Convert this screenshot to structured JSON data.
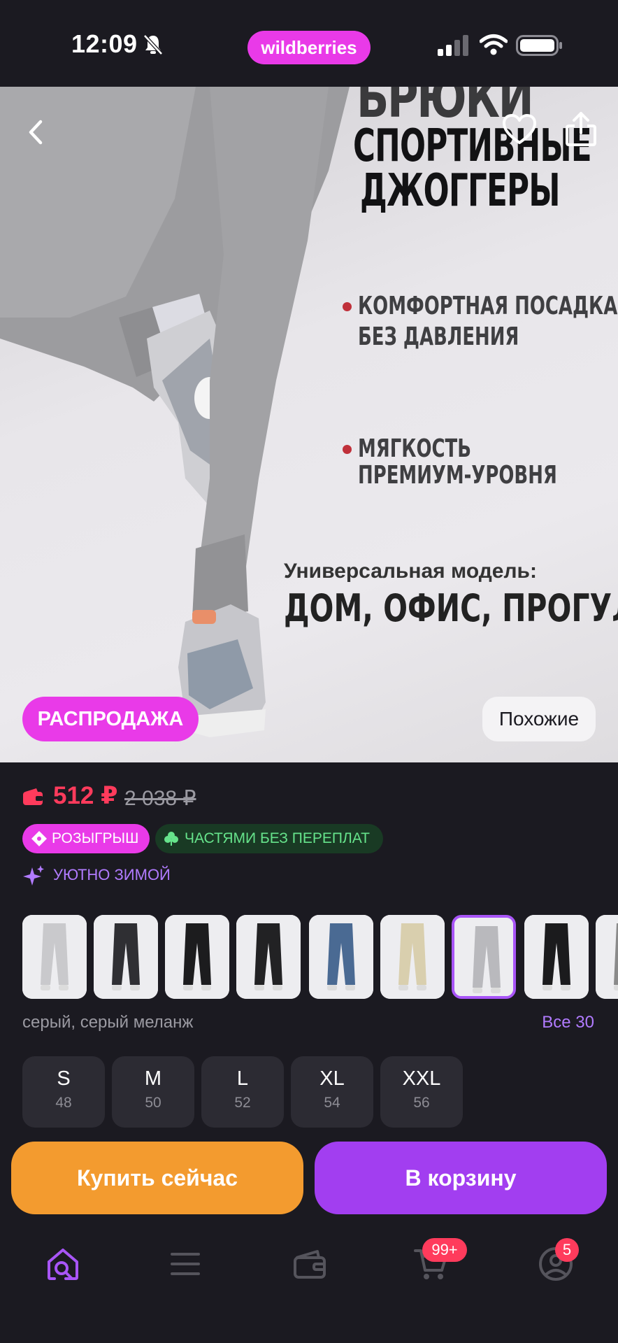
{
  "status_bar": {
    "time": "12:09",
    "app_logo": "wildberries"
  },
  "hero": {
    "title_top": "БРЮКИ",
    "title_line1": "СПОРТИВНЫЕ",
    "title_line2": "ДЖОГГЕРЫ",
    "feature1_line1": "КОМФОРТНАЯ ПОСАДКА",
    "feature1_line2": "БЕЗ ДАВЛЕНИЯ",
    "feature2_line1": "МЯГКОСТЬ",
    "feature2_line2": "ПРЕМИУМ-УРОВНЯ",
    "universal_line1": "Универсальная модель:",
    "universal_line2": "ДОМ, ОФИС, ПРОГУЛКИ",
    "sale_badge": "РАСПРОДАЖА",
    "similar_button": "Похожие"
  },
  "price": {
    "current": "512 ₽",
    "old": "2 038 ₽",
    "accent_color": "#ff3b5c"
  },
  "chips": {
    "raffle": "РОЗЫГРЫШ",
    "installments": "ЧАСТЯМИ БЕЗ ПЕРЕПЛАТ",
    "cozy": "УЮТНО ЗИМОЙ"
  },
  "variants": {
    "selected_index": 6,
    "thumb_colors": [
      "#c9c9cc",
      "#2f2f33",
      "#1c1c1e",
      "#222224",
      "#4a6a93",
      "#d9cfae",
      "#b9b9bd",
      "#1b1b1d",
      "#8a8a8a"
    ],
    "color_label": "серый, серый меланж",
    "all_link": "Все 30"
  },
  "sizes": [
    {
      "size": "S",
      "ru": "48"
    },
    {
      "size": "M",
      "ru": "50"
    },
    {
      "size": "L",
      "ru": "52"
    },
    {
      "size": "XL",
      "ru": "54"
    },
    {
      "size": "XXL",
      "ru": "56"
    }
  ],
  "actions": {
    "buy_now": "Купить сейчас",
    "add_to_cart": "В корзину"
  },
  "tabbar": {
    "items": [
      "home-search-icon",
      "menu-icon",
      "wallet-icon",
      "cart-icon",
      "profile-icon"
    ],
    "cart_badge": "99+",
    "profile_badge": "5",
    "active_color": "#a855f7"
  }
}
